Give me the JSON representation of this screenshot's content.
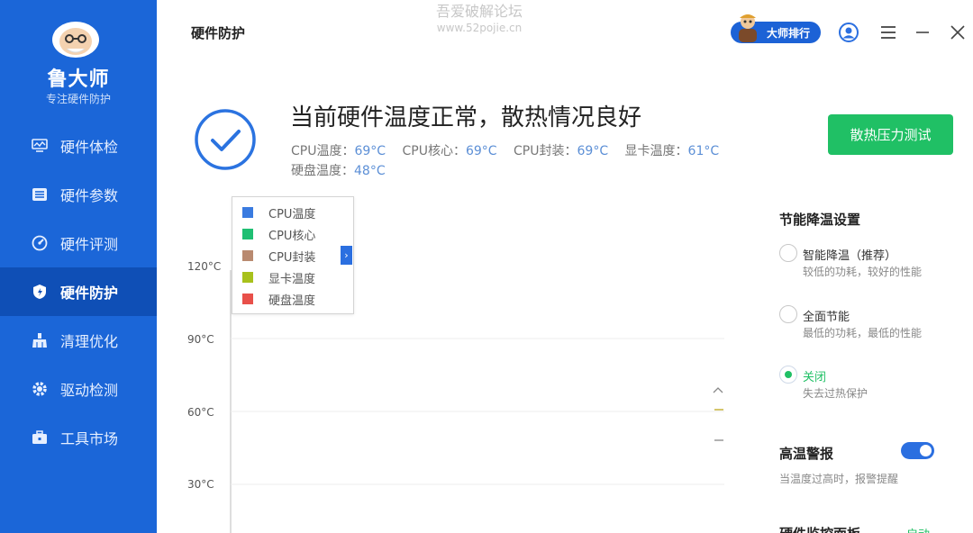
{
  "app": {
    "name": "鲁大师",
    "slogan": "专注硬件防护"
  },
  "sidebar": {
    "items": [
      {
        "label": "硬件体检",
        "icon": "monitor-icon"
      },
      {
        "label": "硬件参数",
        "icon": "list-icon"
      },
      {
        "label": "硬件评测",
        "icon": "gauge-icon"
      },
      {
        "label": "硬件防护",
        "icon": "shield-icon",
        "active": true
      },
      {
        "label": "清理优化",
        "icon": "broom-icon"
      },
      {
        "label": "驱动检测",
        "icon": "gear-icon"
      },
      {
        "label": "工具市场",
        "icon": "toolbox-icon"
      }
    ]
  },
  "header": {
    "title": "硬件防护",
    "watermark_line1": "吾爱破解论坛",
    "watermark_line2": "www.52pojie.cn",
    "rank_label": "大师排行"
  },
  "status": {
    "title": "当前硬件温度正常，散热情况良好",
    "temps": [
      {
        "label": "CPU温度：",
        "value": "69°C"
      },
      {
        "label": "CPU核心：",
        "value": "69°C"
      },
      {
        "label": "CPU封装：",
        "value": "69°C"
      },
      {
        "label": "显卡温度：",
        "value": "61°C"
      },
      {
        "label": "硬盘温度：",
        "value": "48°C"
      }
    ],
    "stress_button": "散热压力测试"
  },
  "chart": {
    "yticks": [
      "120°C",
      "90°C",
      "60°C",
      "30°C"
    ],
    "legend": [
      {
        "name": "CPU温度",
        "color": "#3a7be0"
      },
      {
        "name": "CPU核心",
        "color": "#1fbf73"
      },
      {
        "name": "CPU封装",
        "color": "#b98a70"
      },
      {
        "name": "显卡温度",
        "color": "#a8c11c"
      },
      {
        "name": "硬盘温度",
        "color": "#e8504a"
      }
    ],
    "toggle_glyph": "›"
  },
  "settings": {
    "section_title": "节能降温设置",
    "options": [
      {
        "label": "智能降温（推荐）",
        "desc": "较低的功耗，较好的性能",
        "checked": false
      },
      {
        "label": "全面节能",
        "desc": "最低的功耗，最低的性能",
        "checked": false
      },
      {
        "label": "关闭",
        "desc": "失去过热保护",
        "checked": true
      }
    ],
    "alarm_title": "高温警报",
    "alarm_desc": "当温度过高时，报警提醒",
    "alarm_on": true,
    "monitor_title": "硬件监控面板",
    "monitor_status": "启动"
  }
}
